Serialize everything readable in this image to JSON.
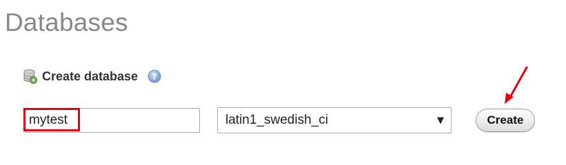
{
  "page": {
    "title": "Databases"
  },
  "create_database": {
    "section_label": "Create database",
    "db_icon": "database-add-icon",
    "help_icon": "help-question-icon",
    "name_input_value": "mytest",
    "collation_selected": "latin1_swedish_ci",
    "collation_caret": "▼",
    "create_button_label": "Create"
  },
  "annotations": {
    "highlight_color": "#e8000b",
    "arrow_color": "#e8000b"
  }
}
